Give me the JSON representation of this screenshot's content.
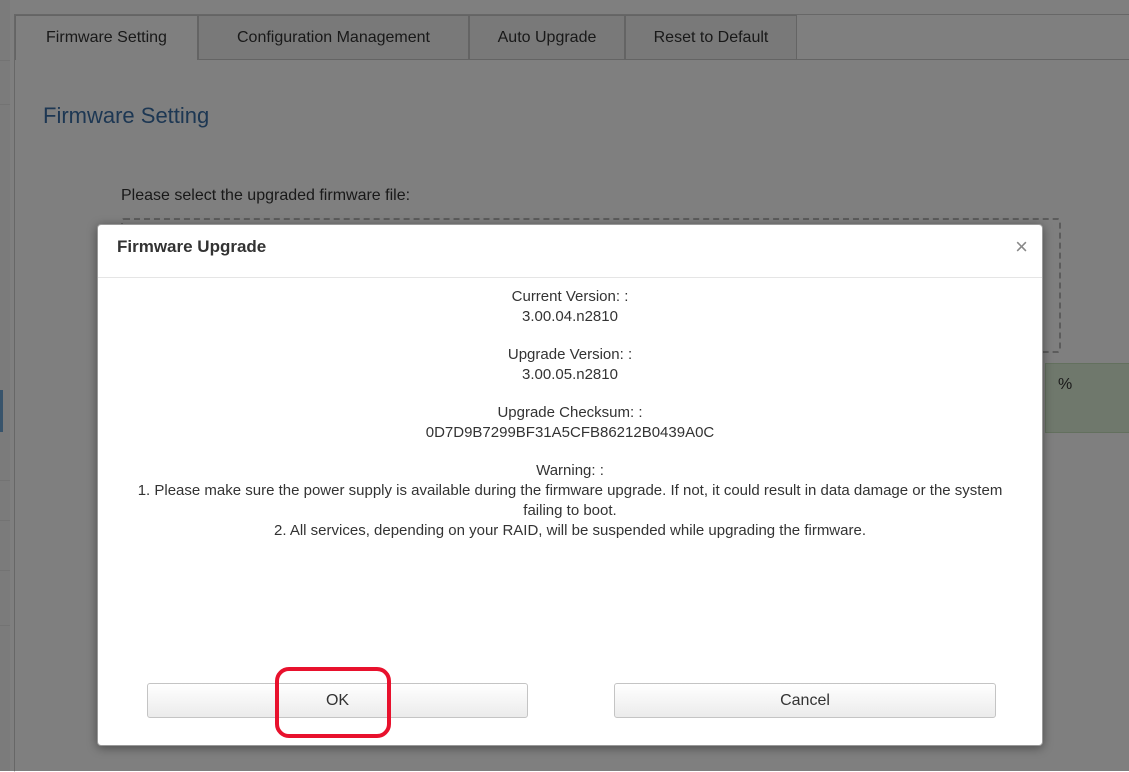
{
  "tabs": [
    {
      "label": "Firmware Setting",
      "active": true
    },
    {
      "label": "Configuration Management",
      "active": false
    },
    {
      "label": "Auto Upgrade",
      "active": false
    },
    {
      "label": "Reset to Default",
      "active": false
    }
  ],
  "page": {
    "title": "Firmware Setting",
    "select_label": "Please select the upgraded firmware file:",
    "status_fragment": "%"
  },
  "modal": {
    "title": "Firmware Upgrade",
    "close_symbol": "×",
    "current_version_label": "Current Version: :",
    "current_version": "3.00.04.n2810",
    "upgrade_version_label": "Upgrade Version: :",
    "upgrade_version": "3.00.05.n2810",
    "checksum_label": "Upgrade Checksum: :",
    "checksum": "0D7D9B7299BF31A5CFB86212B0439A0C",
    "warning_label": "Warning: :",
    "warning_1": "1. Please make sure the power supply is available during the firmware upgrade. If not, it could result in data damage or the system failing to boot.",
    "warning_2": "2. All services, depending on your RAID, will be suspended while upgrading the firmware.",
    "ok_label": "OK",
    "cancel_label": "Cancel"
  },
  "colors": {
    "title_blue": "#3a6fa7",
    "highlight_red": "#e8112d",
    "status_green": "#dff0d8"
  }
}
